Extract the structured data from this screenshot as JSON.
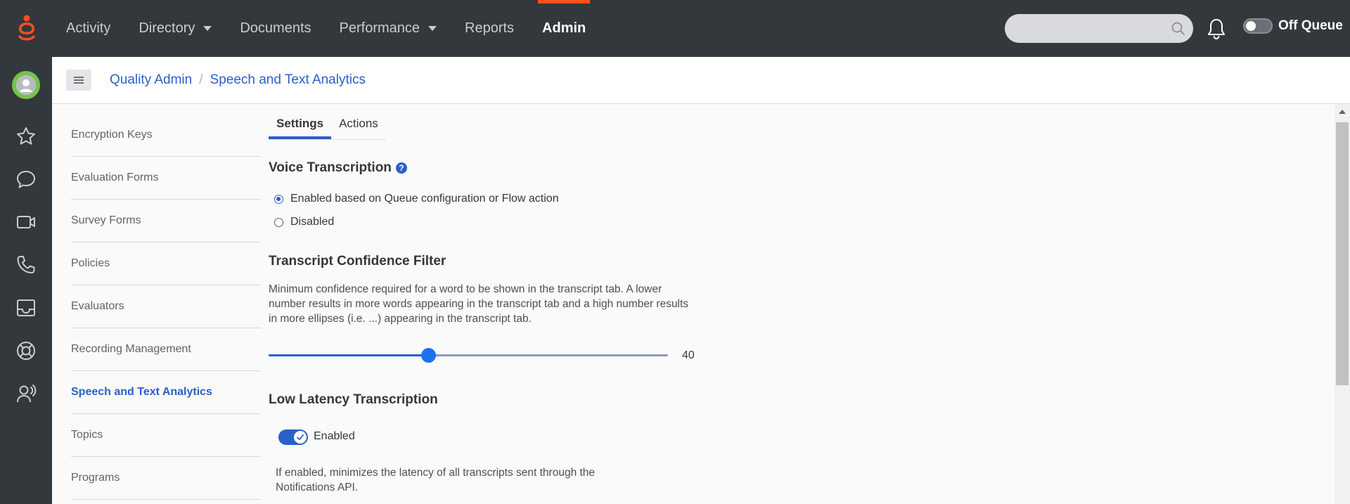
{
  "topbar": {
    "nav": [
      {
        "label": "Activity",
        "has_dropdown": false,
        "active": false
      },
      {
        "label": "Directory",
        "has_dropdown": true,
        "active": false
      },
      {
        "label": "Documents",
        "has_dropdown": false,
        "active": false
      },
      {
        "label": "Performance",
        "has_dropdown": true,
        "active": false
      },
      {
        "label": "Reports",
        "has_dropdown": false,
        "active": false
      },
      {
        "label": "Admin",
        "has_dropdown": false,
        "active": true
      }
    ],
    "search_placeholder": "",
    "queue_status": "Off Queue",
    "queue_toggle_on": false,
    "accent_color": "#ff4f1f",
    "icons": [
      "genesys-logo-icon",
      "search-icon",
      "bell-icon",
      "queue-toggle"
    ]
  },
  "rail": {
    "icons": [
      "avatar",
      "star-icon",
      "chat-bubble-icon",
      "video-icon",
      "phone-icon",
      "inbox-icon",
      "lifebuoy-icon",
      "user-headset-icon"
    ]
  },
  "breadcrumb": [
    "Quality Admin",
    "Speech and Text Analytics"
  ],
  "sidenav": {
    "items": [
      "Encryption Keys",
      "Evaluation Forms",
      "Survey Forms",
      "Policies",
      "Evaluators",
      "Recording Management",
      "Speech and Text Analytics",
      "Topics",
      "Programs"
    ],
    "active_index": 6
  },
  "tabs": [
    {
      "label": "Settings",
      "active": true
    },
    {
      "label": "Actions",
      "active": false
    }
  ],
  "voice_transcription": {
    "title": "Voice Transcription",
    "help_icon": "?",
    "options": [
      {
        "label": "Enabled based on Queue configuration or Flow action",
        "checked": true
      },
      {
        "label": "Disabled",
        "checked": false
      }
    ]
  },
  "confidence_filter": {
    "title": "Transcript Confidence Filter",
    "description": "Minimum confidence required for a word to be shown in the transcript tab. A lower number results in more words appearing in the transcript tab and a high number results in more ellipses (i.e. ...) appearing in the transcript tab.",
    "value": 40,
    "value_label": "40",
    "min": 0,
    "max": 100
  },
  "low_latency": {
    "title": "Low Latency Transcription",
    "enabled": true,
    "toggle_label": "Enabled",
    "description": "If enabled, minimizes the latency of all transcripts sent through the Notifications API."
  },
  "colors": {
    "topbar_bg": "#33383d",
    "link_blue": "#2a60c8",
    "avatar_green": "#75c34a"
  }
}
